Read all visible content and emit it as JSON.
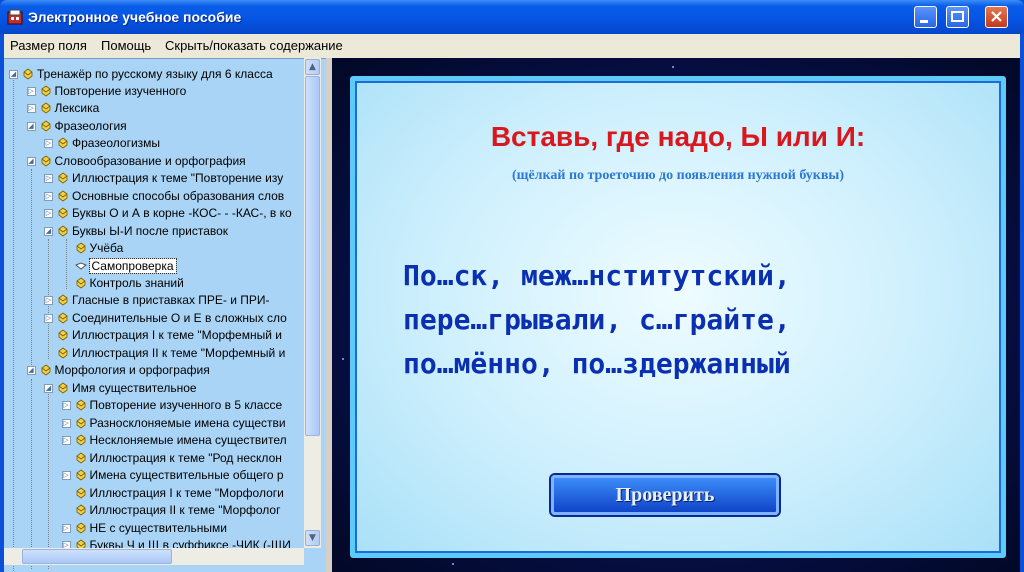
{
  "window": {
    "title": "Электронное учебное пособие"
  },
  "menu": {
    "items": [
      "Размер поля",
      "Помощь",
      "Скрыть/показать содержание"
    ]
  },
  "tree": {
    "items": [
      {
        "label": "Тренажёр по русскому языку для 6 класса"
      },
      {
        "label": "Повторение изученного"
      },
      {
        "label": "Лексика"
      },
      {
        "label": "Фразеология"
      },
      {
        "label": "Фразеологизмы"
      },
      {
        "label": "Словообразование и орфография"
      },
      {
        "label": "Иллюстрация к теме \"Повторение изу"
      },
      {
        "label": "Основные способы образования слов"
      },
      {
        "label": "Буквы О и А в корне -КОС- - -КАС-, в ко"
      },
      {
        "label": "Буквы Ы-И после приставок"
      },
      {
        "label": "Учёба"
      },
      {
        "label": "Самопроверка"
      },
      {
        "label": "Контроль знаний"
      },
      {
        "label": "Гласные в приставках ПРЕ- и ПРИ-"
      },
      {
        "label": "Соединительные О и Е в сложных сло"
      },
      {
        "label": "Иллюстрация I к теме \"Морфемный и"
      },
      {
        "label": "Иллюстрация II к теме \"Морфемный и"
      },
      {
        "label": "Морфология и орфография"
      },
      {
        "label": "Имя существительное"
      },
      {
        "label": "Повторение изученного в 5 классе"
      },
      {
        "label": "Разносклоняемые имена существи"
      },
      {
        "label": "Несклоняемые имена существител"
      },
      {
        "label": "Иллюстрация к теме \"Род несклон"
      },
      {
        "label": "Имена существительные общего р"
      },
      {
        "label": "Иллюстрация I к теме \"Морфологи"
      },
      {
        "label": "Иллюстрация II к теме \"Морфолог"
      },
      {
        "label": "НЕ с существительными"
      },
      {
        "label": "Буквы Ч и Щ в суффиксе -ЧИК (-ЩИ"
      }
    ]
  },
  "exercise": {
    "heading": "Вставь, где надо, Ы или И:",
    "subheading": "(щёлкай по троеточию до появления нужной буквы)",
    "lines": [
      "По…ск, меж…нститутский,",
      "пере…грывали, с…грайте,",
      "по…мённо, по…здержанный"
    ],
    "check_button": "Проверить"
  },
  "colors": {
    "heading": "#d9181d",
    "subheading": "#2c78d6",
    "task_text": "#0a2fb0",
    "tree_bg": "#a9d4f5",
    "card_border": "#5ecaf7"
  }
}
